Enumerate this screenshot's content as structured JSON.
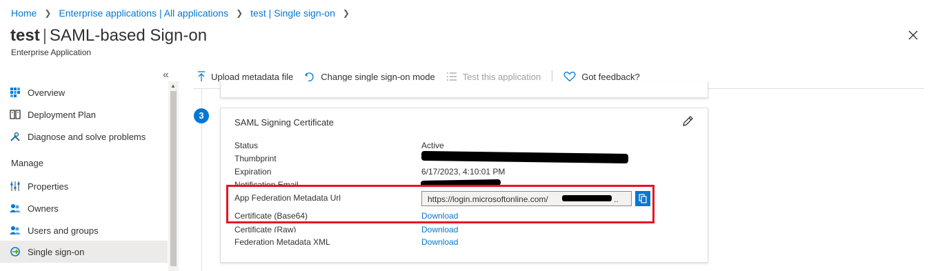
{
  "breadcrumb": {
    "items": [
      "Home",
      "Enterprise applications | All applications",
      "test | Single sign-on"
    ]
  },
  "header": {
    "title_bold": "test",
    "title_bar": "|",
    "title_rest": "SAML-based Sign-on",
    "subtitle": "Enterprise Application"
  },
  "sidebar": {
    "items": [
      {
        "label": "Overview",
        "icon": "grid-icon"
      },
      {
        "label": "Deployment Plan",
        "icon": "book-icon"
      },
      {
        "label": "Diagnose and solve problems",
        "icon": "wrench-icon"
      }
    ],
    "section_manage": "Manage",
    "manage_items": [
      {
        "label": "Properties",
        "icon": "sliders-icon"
      },
      {
        "label": "Owners",
        "icon": "people-icon"
      },
      {
        "label": "Users and groups",
        "icon": "people-icon"
      },
      {
        "label": "Single sign-on",
        "icon": "sso-icon",
        "active": true
      }
    ]
  },
  "toolbar": {
    "upload": "Upload metadata file",
    "change_mode": "Change single sign-on mode",
    "test_app": "Test this application",
    "feedback": "Got feedback?"
  },
  "step_number": "3",
  "card": {
    "title": "SAML Signing Certificate",
    "rows": [
      {
        "label": "Status",
        "value": "Active"
      },
      {
        "label": "Thumbprint",
        "value": ""
      },
      {
        "label": "Expiration",
        "value": "6/17/2023, 4:10:01 PM"
      },
      {
        "label": "Notification Email",
        "value": ""
      },
      {
        "label": "App Federation Metadata Url",
        "value": "https://login.microsoftonline.com/"
      },
      {
        "label": "Certificate (Base64)",
        "value": "Download"
      },
      {
        "label": "Certificate (Raw)",
        "value": "Download"
      },
      {
        "label": "Federation Metadata XML",
        "value": "Download"
      }
    ],
    "url_ellipsis": ".."
  },
  "colors": {
    "accent": "#0078d4",
    "highlight": "#e81123",
    "active_nav": "#edebe9"
  }
}
